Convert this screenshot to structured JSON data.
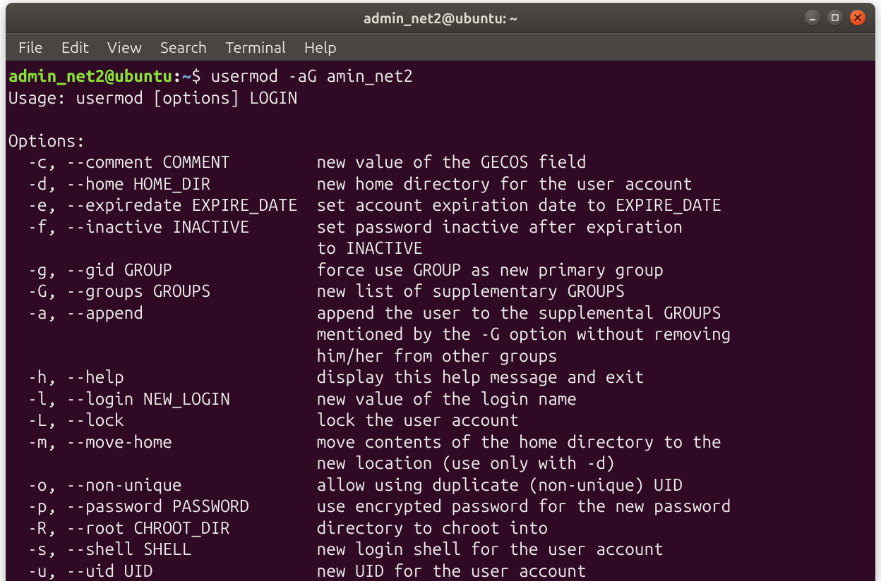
{
  "titlebar": {
    "title": "admin_net2@ubuntu: ~"
  },
  "menu": {
    "file": "File",
    "edit": "Edit",
    "view": "View",
    "search": "Search",
    "terminal": "Terminal",
    "help": "Help"
  },
  "prompt": {
    "user_host": "admin_net2@ubuntu",
    "colon": ":",
    "path": "~",
    "dollar": "$ "
  },
  "command": "usermod -aG amin_net2",
  "output": {
    "usage": "Usage: usermod [options] LOGIN",
    "blank1": "",
    "options_hdr": "Options:",
    "l01": "  -c, --comment COMMENT         new value of the GECOS field",
    "l02": "  -d, --home HOME_DIR           new home directory for the user account",
    "l03": "  -e, --expiredate EXPIRE_DATE  set account expiration date to EXPIRE_DATE",
    "l04": "  -f, --inactive INACTIVE       set password inactive after expiration",
    "l05": "                                to INACTIVE",
    "l06": "  -g, --gid GROUP               force use GROUP as new primary group",
    "l07": "  -G, --groups GROUPS           new list of supplementary GROUPS",
    "l08": "  -a, --append                  append the user to the supplemental GROUPS",
    "l09": "                                mentioned by the -G option without removing",
    "l10": "                                him/her from other groups",
    "l11": "  -h, --help                    display this help message and exit",
    "l12": "  -l, --login NEW_LOGIN         new value of the login name",
    "l13": "  -L, --lock                    lock the user account",
    "l14": "  -m, --move-home               move contents of the home directory to the",
    "l15": "                                new location (use only with -d)",
    "l16": "  -o, --non-unique              allow using duplicate (non-unique) UID",
    "l17": "  -p, --password PASSWORD       use encrypted password for the new password",
    "l18": "  -R, --root CHROOT_DIR         directory to chroot into",
    "l19": "  -s, --shell SHELL             new login shell for the user account",
    "l20": "  -u, --uid UID                 new UID for the user account"
  }
}
